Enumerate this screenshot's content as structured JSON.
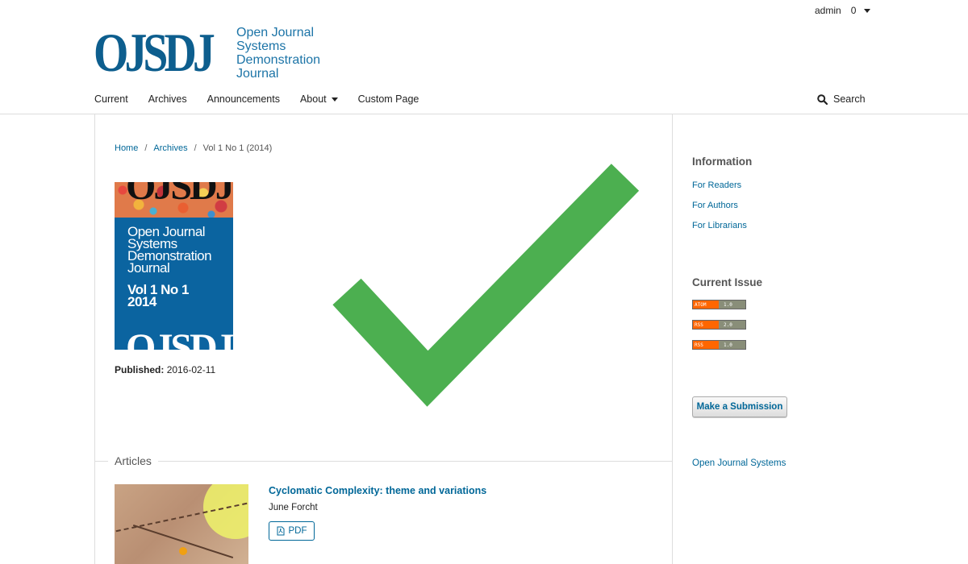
{
  "user_nav": {
    "username": "admin",
    "task_count": "0"
  },
  "logo": {
    "mark": "OJSDJ",
    "lines": [
      "Open Journal",
      "Systems",
      "Demonstration",
      "Journal"
    ]
  },
  "nav": {
    "items": [
      "Current",
      "Archives",
      "Announcements",
      "About",
      "Custom Page"
    ],
    "search": "Search"
  },
  "breadcrumb": {
    "home": "Home",
    "archives": "Archives",
    "current": "Vol 1 No 1 (2014)"
  },
  "cover": {
    "mark": "OJSDJ",
    "title_lines": [
      "Open Journal",
      "Systems",
      "Demonstration",
      "Journal"
    ],
    "vol_lines": [
      "Vol 1 No 1",
      "2014"
    ]
  },
  "published": {
    "label": "Published:",
    "date": "2016-02-11"
  },
  "articles": {
    "heading": "Articles",
    "items": [
      {
        "title": "Cyclomatic Complexity: theme and variations",
        "author": "June Forcht",
        "galley": "PDF"
      }
    ]
  },
  "sidebar": {
    "info_title": "Information",
    "info_links": [
      "For Readers",
      "For Authors",
      "For Librarians"
    ],
    "current_issue_title": "Current Issue",
    "feeds": [
      {
        "left": "ATOM",
        "right": "1.0"
      },
      {
        "left": "RSS",
        "right": "2.0"
      },
      {
        "left": "RSS",
        "right": "1.0"
      }
    ],
    "submit": "Make a Submission",
    "ojs_link": "Open Journal Systems"
  },
  "colors": {
    "link": "#006798",
    "logo": "#0d5e8e",
    "check": "#4caf50",
    "cover": "#0b64a0"
  }
}
